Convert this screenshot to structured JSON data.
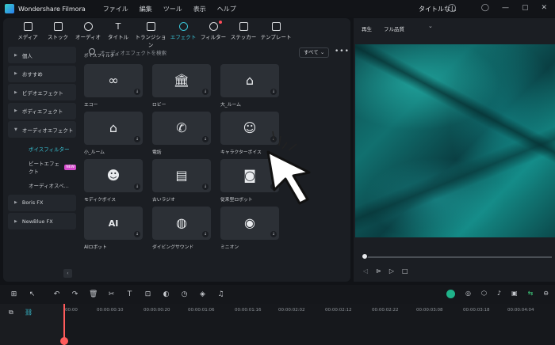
{
  "app": {
    "name": "Wondershare Filmora",
    "menu": [
      "ファイル",
      "編集",
      "ツール",
      "表示",
      "ヘルプ"
    ],
    "document_title": "タイトルなし"
  },
  "toolbar": {
    "tabs": [
      "メディア",
      "ストック",
      "オーディオ",
      "タイトル",
      "トランジション",
      "エフェクト",
      "フィルター",
      "ステッカー",
      "テンプレート"
    ],
    "active_tab": "エフェクト"
  },
  "sidebar": {
    "items": [
      "個人",
      "おすすめ",
      "ビデオエフェクト",
      "ボディエフェクト",
      "オーディオエフェクト"
    ],
    "sub_items": [
      "ボイスフィルター",
      "ビートエフェクト",
      "オーディオスペ..."
    ],
    "sub_badge": "NEW",
    "extra_items": [
      "Boris FX",
      "NewBlue FX"
    ]
  },
  "search": {
    "placeholder": "オーディオエフェクトを検索",
    "filter_label": "すべて"
  },
  "section_title": "ボイスフィルター",
  "effects": [
    {
      "label": "エコー",
      "icon": "infinity-icon"
    },
    {
      "label": "ロビー",
      "icon": "building-icon"
    },
    {
      "label": "大_ルーム",
      "icon": "house-icon"
    },
    {
      "label": "小_ルーム",
      "icon": "small-house-icon"
    },
    {
      "label": "電話",
      "icon": "phone-icon"
    },
    {
      "label": "キャラクターボイス",
      "icon": "character-face-icon"
    },
    {
      "label": "モディクボイス",
      "icon": "mask-icon"
    },
    {
      "label": "古いラジオ",
      "icon": "radio-icon"
    },
    {
      "label": "従来型ロボット",
      "icon": "robot-icon"
    },
    {
      "label": "AIロボット",
      "icon": "ai-icon"
    },
    {
      "label": "ダイビングサウンド",
      "icon": "diving-mask-icon"
    },
    {
      "label": "ミニオン",
      "icon": "minion-icon"
    }
  ],
  "preview": {
    "play_label": "再生",
    "quality": "フル品質"
  },
  "timeline": {
    "ticks": [
      "00:00",
      "00:00:00:10",
      "00:00:00:20",
      "00:00:01:06",
      "00:00:01:16",
      "00:00:02:02",
      "00:00:02:12",
      "00:00:02:22",
      "00:00:03:08",
      "00:00:03:18",
      "00:00:04:04"
    ]
  },
  "colors": {
    "accent": "#39c5d7",
    "panel": "#1b1e23",
    "card": "#2c3036",
    "playhead": "#ff5b5b"
  }
}
